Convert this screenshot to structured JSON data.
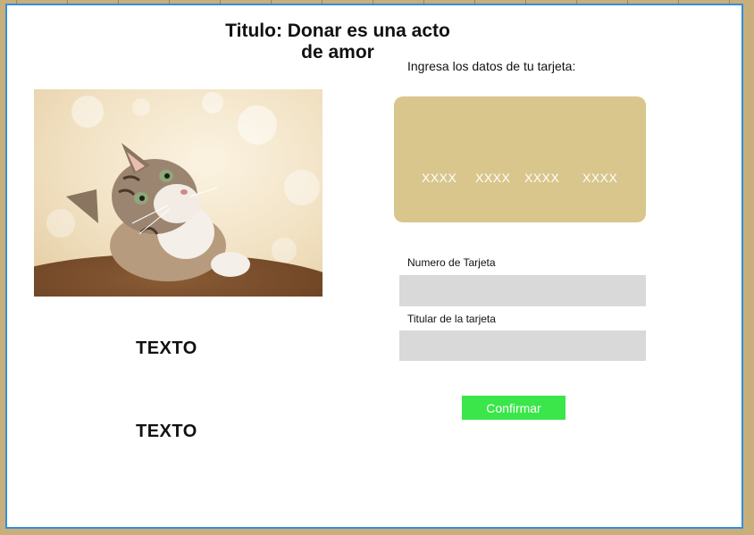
{
  "page": {
    "title": "Titulo: Donar es una acto de amor"
  },
  "left": {
    "image_alt": "cat-photo",
    "text_1": "TEXTO",
    "text_2": "TEXTO"
  },
  "payment": {
    "instructions": "Ingresa los datos de tu tarjeta:",
    "card_groups": [
      "XXXX",
      "XXXX",
      "XXXX",
      "XXXX"
    ],
    "card_number_label": "Numero de Tarjeta",
    "card_number_value": "",
    "card_holder_label": "Titular de la tarjeta",
    "card_holder_value": "",
    "confirm_label": "Confirmar"
  },
  "colors": {
    "background": "#C8AE7A",
    "frame_border": "#2F8FE0",
    "card": "#D9C68C",
    "field": "#D9D9D9",
    "confirm": "#3BE64A"
  }
}
